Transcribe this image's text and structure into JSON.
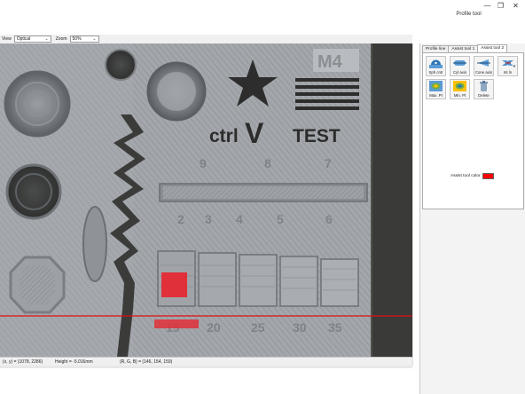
{
  "window": {
    "title": "Profile tool",
    "minimize_glyph": "—",
    "restore_glyph": "❐",
    "close_glyph": "✕"
  },
  "toolbar": {
    "view_label": "View",
    "view_value": "Optical",
    "zoom_label": "Zoom",
    "zoom_value": "50%"
  },
  "image": {
    "plate_label": "M4",
    "logo_text_left": "ctrl",
    "logo_text_mid": "V",
    "logo_text_right": "TEST",
    "row1_numbers": [
      "9",
      "8",
      "7"
    ],
    "row2_numbers": [
      "2",
      "3",
      "4",
      "5",
      "6"
    ],
    "row3_numbers": [
      "15",
      "20",
      "25",
      "30",
      "35"
    ],
    "profile_line_color": "#e01010"
  },
  "statusbar": {
    "xy": "(x, y) = (1078, 2286)",
    "height": "Height = -5.016mm",
    "rgb": "(R, G, B) = (146, 154, 159)"
  },
  "panel": {
    "tabs": [
      {
        "label": "Profile line",
        "active": false
      },
      {
        "label": "Assist tool 1",
        "active": false
      },
      {
        "label": "Assist tool 2",
        "active": true
      }
    ],
    "tools": [
      {
        "label": "Sph cntr",
        "icon": "sphere-center-icon"
      },
      {
        "label": "Cyl axis",
        "icon": "cylinder-axis-icon"
      },
      {
        "label": "Cone axis",
        "icon": "cone-axis-icon"
      },
      {
        "label": "Int ln",
        "icon": "intersection-line-icon"
      },
      {
        "label": "Max. Pt",
        "icon": "max-point-icon"
      },
      {
        "label": "Min. Pt",
        "icon": "min-point-icon"
      },
      {
        "label": "Delete",
        "icon": "trash-icon"
      }
    ],
    "assist_color_label": "Assist tool color",
    "assist_color": "#ff0000"
  }
}
